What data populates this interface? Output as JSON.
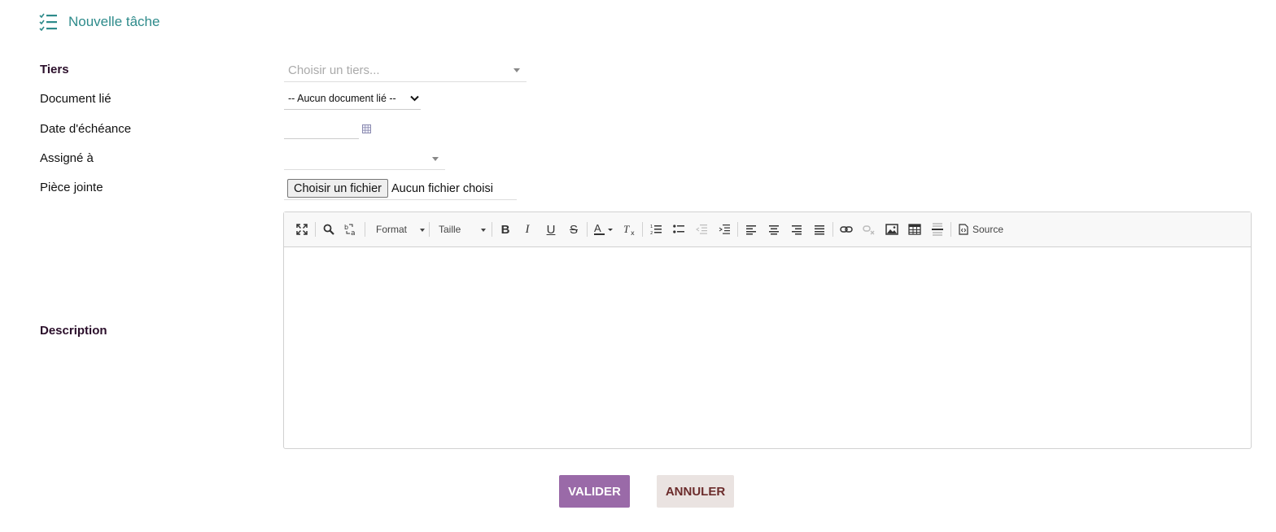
{
  "header": {
    "title": "Nouvelle tâche",
    "icon": "task-list-icon",
    "accent": "#2e8b8b"
  },
  "form": {
    "tiers": {
      "label": "Tiers",
      "placeholder": "Choisir un tiers..."
    },
    "document": {
      "label": "Document lié",
      "value": "-- Aucun document lié --"
    },
    "due_date": {
      "label": "Date d'échéance",
      "value": ""
    },
    "assigned": {
      "label": "Assigné à",
      "value": ""
    },
    "attachment": {
      "label": "Pièce jointe",
      "button": "Choisir un fichier",
      "status": "Aucun fichier choisi"
    },
    "description": {
      "label": "Description",
      "value": ""
    }
  },
  "editor_toolbar": {
    "format_label": "Format",
    "size_label": "Taille",
    "source_label": "Source",
    "icons": [
      "maximize-icon",
      "find-icon",
      "replace-icon",
      "bold-icon",
      "italic-icon",
      "underline-icon",
      "strike-icon",
      "text-color-icon",
      "remove-format-icon",
      "numbered-list-icon",
      "bulleted-list-icon",
      "outdent-icon",
      "indent-icon",
      "align-left-icon",
      "align-center-icon",
      "align-right-icon",
      "justify-icon",
      "link-icon",
      "unlink-icon",
      "image-icon",
      "table-icon",
      "horizontal-rule-icon",
      "source-icon"
    ]
  },
  "actions": {
    "validate": "VALIDER",
    "cancel": "ANNULER",
    "validate_color": "#9a6aa8",
    "cancel_color": "#eae3e1"
  }
}
